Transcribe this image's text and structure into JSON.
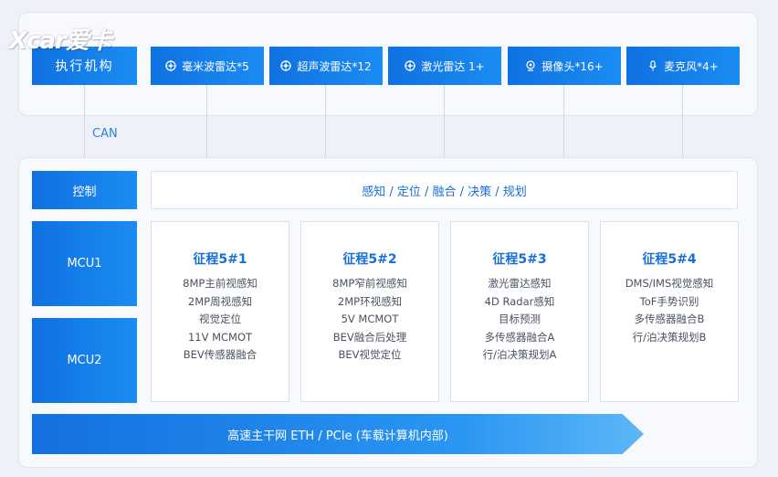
{
  "logo": {
    "text": "Xcar爱卡"
  },
  "top": {
    "actuator": "执行机构",
    "sensors": [
      {
        "label": "毫米波雷达*5",
        "icon": "radar-icon"
      },
      {
        "label": "超声波雷达*12",
        "icon": "radar-icon"
      },
      {
        "label": "激光雷达 1+",
        "icon": "radar-icon"
      },
      {
        "label": "摄像头*16+",
        "icon": "camera-icon"
      },
      {
        "label": "麦克风*4+",
        "icon": "microphone-icon"
      }
    ]
  },
  "can_label": "CAN",
  "left_blocks": {
    "control": "控制",
    "mcu1": "MCU1",
    "mcu2": "MCU2"
  },
  "perception_bar": "感知 / 定位 / 融合 / 决策 / 规划",
  "chips": [
    {
      "title": "征程5#1",
      "lines": [
        "8MP主前视感知",
        "2MP周视感知",
        "视觉定位",
        "11V MCMOT",
        "BEV传感器融合"
      ]
    },
    {
      "title": "征程5#2",
      "lines": [
        "8MP窄前视感知",
        "2MP环视感知",
        "5V MCMOT",
        "BEV融合后处理",
        "BEV视觉定位"
      ]
    },
    {
      "title": "征程5#3",
      "lines": [
        "激光雷达感知",
        "4D Radar感知",
        "目标预测",
        "多传感器融合A",
        "行/泊决策规划A"
      ]
    },
    {
      "title": "征程5#4",
      "lines": [
        "DMS/IMS视觉感知",
        "ToF手势识别",
        "多传感器融合B",
        "行/泊决策规划B"
      ]
    }
  ],
  "eth_bar": "高速主干网 ETH / PCIe (车载计算机内部)",
  "colors": {
    "accent": "#1a80ec",
    "text_blue": "#1a6fd6",
    "card_text": "#4a5261"
  }
}
